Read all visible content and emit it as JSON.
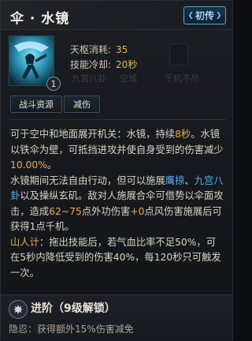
{
  "header": {
    "title": "伞 · 水镜",
    "badge": "初传"
  },
  "skill": {
    "level_badge": "1",
    "stats": [
      {
        "label": "天枢消耗:",
        "value": "35"
      },
      {
        "label": "技能冷却:",
        "value": "20秒"
      }
    ],
    "slots": [
      "九宫八卦",
      "空城",
      "千机不尽"
    ],
    "tags": [
      "战斗资源",
      "减伤"
    ]
  },
  "description": {
    "p1": {
      "a": "可于空中和地面展开机关：水镜，持续",
      "dur": "8秒",
      "b": "。水镜以铁伞为壁，可抵挡进攻并使自身受到的伤害减少",
      "pct": "10.00%",
      "c": "。"
    },
    "p2": {
      "a": "水镜期间无法自由行动，但可以施展",
      "s1": "鹰掠",
      "b": "、",
      "s2": "九宫八卦",
      "c": "以及操纵玄矶。敌对人施展合伞可借势以伞面攻击，造成",
      "dmg": "62~75",
      "d": "点外功伤害",
      "pts": "+0",
      "e": "点风伤害施展后可获得1点千机。"
    },
    "p3": {
      "label": "山人计",
      "text": "：拖出技能后，若气血比率不足50%，可在5秒内降低受到的伤害40%，每120秒只可触发一次。"
    }
  },
  "advance": {
    "title": "进阶（9级解锁）",
    "sub_label": "隐忍：",
    "sub_text": "获得额外15%伤害减免"
  },
  "colors": {
    "accent_gold": "#e7b04e",
    "accent_blue": "#5fb0ef",
    "accent_red": "#e0684f",
    "badge_border": "#5aa7d6"
  }
}
